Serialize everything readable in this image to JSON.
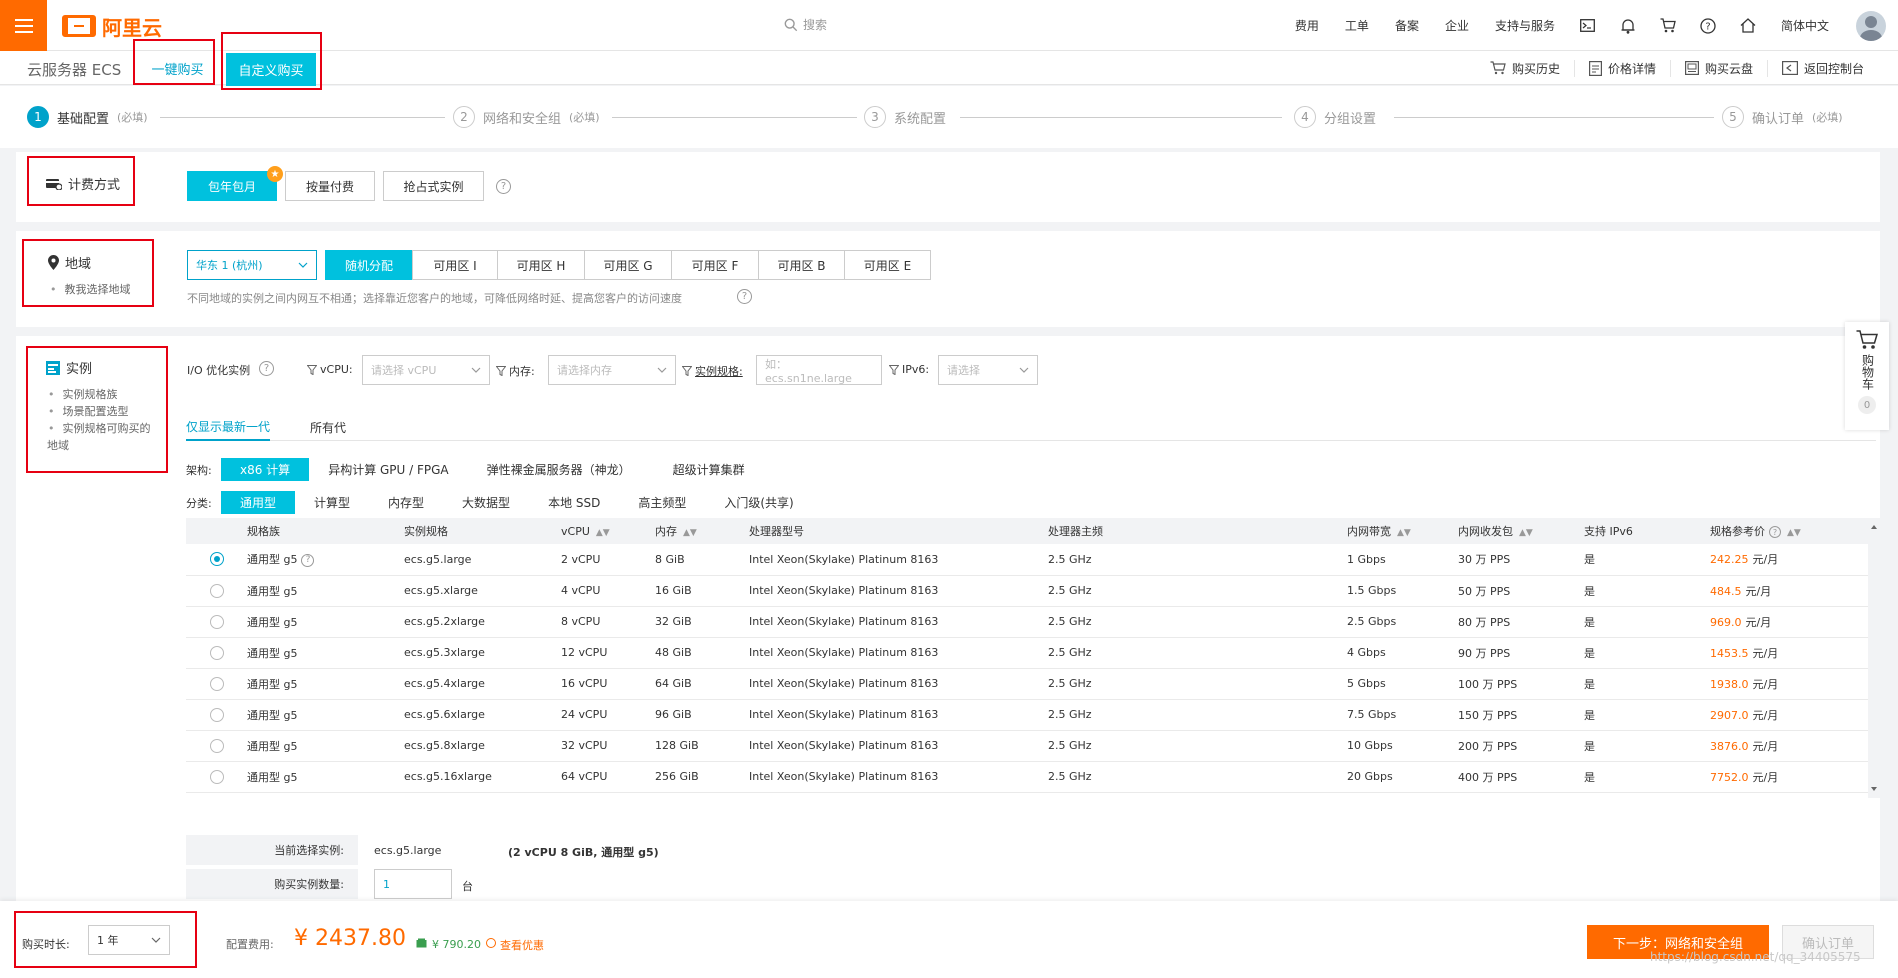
{
  "topbar": {
    "logo_text": "阿里云",
    "search_placeholder": "搜索",
    "links": [
      "费用",
      "工单",
      "备案",
      "企业",
      "支持与服务"
    ],
    "language": "简体中文",
    "icons": [
      "terminal-icon",
      "bell-icon",
      "cart-icon",
      "help-icon",
      "home-icon"
    ]
  },
  "subbar": {
    "product": "云服务器 ECS",
    "tab_quick": "一键购买",
    "tab_custom": "自定义购买",
    "actions": [
      {
        "label": "购买历史",
        "icon": "cart-history-icon"
      },
      {
        "label": "价格详情",
        "icon": "price-detail-icon"
      },
      {
        "label": "购买云盘",
        "icon": "disk-icon"
      },
      {
        "label": "返回控制台",
        "icon": "console-return-icon"
      }
    ]
  },
  "steps": [
    {
      "num": "1",
      "name": "基础配置",
      "note": "(必填)"
    },
    {
      "num": "2",
      "name": "网络和安全组",
      "note": "(必填)"
    },
    {
      "num": "3",
      "name": "系统配置",
      "note": ""
    },
    {
      "num": "4",
      "name": "分组设置",
      "note": ""
    },
    {
      "num": "5",
      "name": "确认订单",
      "note": "(必填)"
    }
  ],
  "billing": {
    "label": "计费方式",
    "options": [
      "包年包月",
      "按量付费",
      "抢占式实例"
    ],
    "badge": "★"
  },
  "region": {
    "label": "地域",
    "sub": [
      "教我选择地域"
    ],
    "selected": "华东 1 (杭州)",
    "zones": [
      "随机分配",
      "可用区 I",
      "可用区 H",
      "可用区 G",
      "可用区 F",
      "可用区 B",
      "可用区 E"
    ],
    "hint": "不同地域的实例之间内网互不相通；选择靠近您客户的地域，可降低网络时延、提高您客户的访问速度"
  },
  "instance": {
    "label": "实例",
    "sub": [
      "实例规格族",
      "场景配置选型",
      "实例规格可购买的",
      "地域"
    ],
    "io_label": "I/O 优化实例",
    "filters": {
      "vcpu_label": "vCPU:",
      "vcpu_placeholder": "请选择 vCPU",
      "mem_label": "内存:",
      "mem_placeholder": "请选择内存",
      "spec_label": "实例规格:",
      "spec_placeholder": "如：ecs.sn1ne.large",
      "ipv6_label": "IPv6:",
      "ipv6_placeholder": "请选择"
    },
    "gen_tabs": [
      "仅显示最新一代",
      "所有代"
    ],
    "arch_label": "架构:",
    "arch": [
      "x86 计算",
      "异构计算 GPU / FPGA",
      "弹性裸金属服务器（神龙）",
      "超级计算集群"
    ],
    "cat_label": "分类:",
    "categories": [
      "通用型",
      "计算型",
      "内存型",
      "大数据型",
      "本地 SSD",
      "高主频型",
      "入门级(共享)"
    ],
    "columns": [
      "规格族",
      "实例规格",
      "vCPU",
      "内存",
      "处理器型号",
      "处理器主频",
      "内网带宽",
      "内网收发包",
      "支持 IPv6",
      "规格参考价"
    ],
    "rows": [
      {
        "family": "通用型 g5",
        "spec": "ecs.g5.large",
        "vcpu": "2 vCPU",
        "mem": "8 GiB",
        "cpu": "Intel Xeon(Skylake) Platinum 8163",
        "freq": "2.5 GHz",
        "bw": "1 Gbps",
        "pps": "30 万 PPS",
        "ipv6": "是",
        "price": "242.25",
        "unit": "元/月"
      },
      {
        "family": "通用型 g5",
        "spec": "ecs.g5.xlarge",
        "vcpu": "4 vCPU",
        "mem": "16 GiB",
        "cpu": "Intel Xeon(Skylake) Platinum 8163",
        "freq": "2.5 GHz",
        "bw": "1.5 Gbps",
        "pps": "50 万 PPS",
        "ipv6": "是",
        "price": "484.5",
        "unit": "元/月"
      },
      {
        "family": "通用型 g5",
        "spec": "ecs.g5.2xlarge",
        "vcpu": "8 vCPU",
        "mem": "32 GiB",
        "cpu": "Intel Xeon(Skylake) Platinum 8163",
        "freq": "2.5 GHz",
        "bw": "2.5 Gbps",
        "pps": "80 万 PPS",
        "ipv6": "是",
        "price": "969.0",
        "unit": "元/月"
      },
      {
        "family": "通用型 g5",
        "spec": "ecs.g5.3xlarge",
        "vcpu": "12 vCPU",
        "mem": "48 GiB",
        "cpu": "Intel Xeon(Skylake) Platinum 8163",
        "freq": "2.5 GHz",
        "bw": "4 Gbps",
        "pps": "90 万 PPS",
        "ipv6": "是",
        "price": "1453.5",
        "unit": "元/月"
      },
      {
        "family": "通用型 g5",
        "spec": "ecs.g5.4xlarge",
        "vcpu": "16 vCPU",
        "mem": "64 GiB",
        "cpu": "Intel Xeon(Skylake) Platinum 8163",
        "freq": "2.5 GHz",
        "bw": "5 Gbps",
        "pps": "100 万 PPS",
        "ipv6": "是",
        "price": "1938.0",
        "unit": "元/月"
      },
      {
        "family": "通用型 g5",
        "spec": "ecs.g5.6xlarge",
        "vcpu": "24 vCPU",
        "mem": "96 GiB",
        "cpu": "Intel Xeon(Skylake) Platinum 8163",
        "freq": "2.5 GHz",
        "bw": "7.5 Gbps",
        "pps": "150 万 PPS",
        "ipv6": "是",
        "price": "2907.0",
        "unit": "元/月"
      },
      {
        "family": "通用型 g5",
        "spec": "ecs.g5.8xlarge",
        "vcpu": "32 vCPU",
        "mem": "128 GiB",
        "cpu": "Intel Xeon(Skylake) Platinum 8163",
        "freq": "2.5 GHz",
        "bw": "10 Gbps",
        "pps": "200 万 PPS",
        "ipv6": "是",
        "price": "3876.0",
        "unit": "元/月"
      },
      {
        "family": "通用型 g5",
        "spec": "ecs.g5.16xlarge",
        "vcpu": "64 vCPU",
        "mem": "256 GiB",
        "cpu": "Intel Xeon(Skylake) Platinum 8163",
        "freq": "2.5 GHz",
        "bw": "20 Gbps",
        "pps": "400 万 PPS",
        "ipv6": "是",
        "price": "7752.0",
        "unit": "元/月"
      }
    ],
    "selected_label": "当前选择实例:",
    "selected_value": "ecs.g5.large",
    "selected_desc": "(2 vCPU 8 GiB, 通用型 g5)",
    "qty_label": "购买实例数量:",
    "qty_value": "1",
    "qty_unit": "台"
  },
  "cart": {
    "label": "购物车",
    "count": "0"
  },
  "footer": {
    "duration_label": "购买时长:",
    "duration_value": "1 年",
    "fee_label": "配置费用:",
    "fee_value": "¥ 2437.80",
    "save_value": "¥ 790.20",
    "discount_link": "查看优惠",
    "next_button": "下一步：网络和安全组",
    "confirm_button": "确认订单"
  },
  "watermark": "https://blog.csdn.net/qq_34405575",
  "colors": {
    "brand": "#ff6a00",
    "accent": "#00c1de",
    "link": "#00a2ca",
    "annotation": "#e60012"
  }
}
